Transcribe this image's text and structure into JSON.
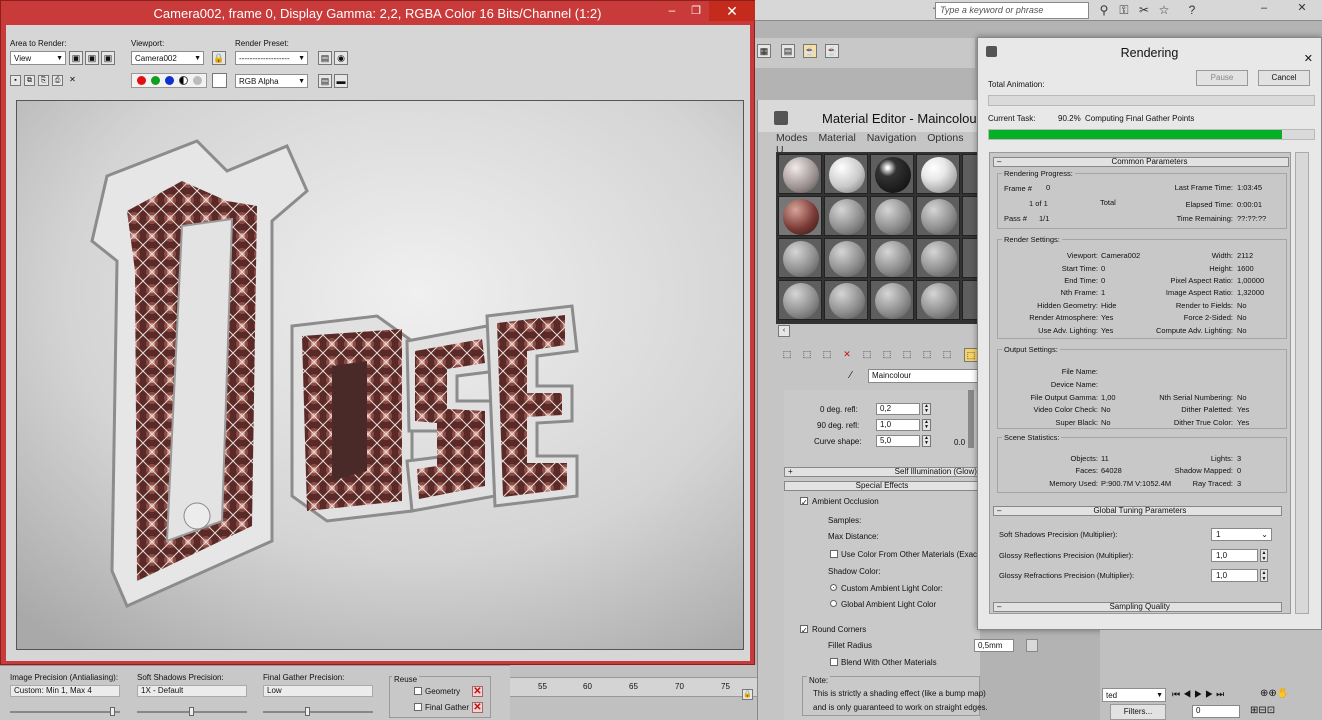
{
  "background": {
    "search_placeholder": "Type a keyword or phrase",
    "window_controls": [
      "–",
      "❐",
      "✕"
    ]
  },
  "vfb": {
    "title": "Camera002, frame 0, Display Gamma: 2,2, RGBA Color 16 Bits/Channel (1:2)",
    "area_label": "Area to Render:",
    "area_value": "View",
    "viewport_label": "Viewport:",
    "viewport_value": "Camera002",
    "preset_label": "Render Preset:",
    "preset_value": "-------------------",
    "channel_value": "RGB Alpha"
  },
  "bottom": {
    "image_precision_label": "Image Precision (Antialiasing):",
    "image_precision_value": "Custom: Min 1, Max 4",
    "soft_shadows_label": "Soft Shadows Precision:",
    "soft_shadows_value": "1X - Default",
    "final_gather_label": "Final Gather Precision:",
    "final_gather_value": "Low",
    "reuse_label": "Reuse",
    "geometry_label": "Geometry",
    "final_gather_check_label": "Final Gather",
    "timeline_ticks": [
      "55",
      "60",
      "65",
      "70",
      "75"
    ]
  },
  "material_editor": {
    "title": "Material Editor - Maincolour",
    "menu": [
      "Modes",
      "Material",
      "Navigation",
      "Options",
      "U"
    ],
    "material_name": "Maincolour",
    "refl_0_label": "0 deg. refl:",
    "refl_0_value": "0,2",
    "refl_90_label": "90 deg. refl:",
    "refl_90_value": "1,0",
    "curve_label": "Curve shape:",
    "curve_value": "5,0",
    "graph_value": "0.0",
    "self_illum": "Self Illumination (Glow)",
    "special_effects": "Special Effects",
    "ambient_occlusion": "Ambient Occlusion",
    "samples": "Samples:",
    "max_distance": "Max Distance:",
    "use_color": "Use Color From Other Materials (Exact A",
    "shadow_color": "Shadow Color:",
    "custom_ambient": "Custom Ambient Light Color:",
    "global_ambient": "Global Ambient Light Color",
    "round_corners": "Round Corners",
    "fillet_radius": "Fillet Radius",
    "fillet_value": "0,5mm",
    "blend": "Blend With Other Materials",
    "note_title": "Note:",
    "note_line1": "This is strictly a shading effect (like a bump map)",
    "note_line2": "and is only guaranteed to work on straight edges."
  },
  "rendering": {
    "title": "Rendering",
    "pause": "Pause",
    "cancel": "Cancel",
    "total_animation": "Total Animation:",
    "current_task_label": "Current Task:",
    "current_task_percent": "90.2%",
    "current_task_text": "Computing Final Gather Points",
    "current_task_progress": 0.902,
    "total_animation_progress": 0.0,
    "common_parameters": "Common Parameters",
    "progress": {
      "title": "Rendering Progress:",
      "frame_label": "Frame #",
      "frame_value": "0",
      "of_value": "1 of 1",
      "total": "Total",
      "pass_label": "Pass #",
      "pass_value": "1/1",
      "last_frame_label": "Last Frame Time:",
      "last_frame_value": "1:03:45",
      "elapsed_label": "Elapsed Time:",
      "elapsed_value": "0:00:01",
      "remaining_label": "Time Remaining:",
      "remaining_value": "??:??:??"
    },
    "render_settings": {
      "title": "Render Settings:",
      "left": [
        [
          "Viewport:",
          "Camera002"
        ],
        [
          "Start Time:",
          "0"
        ],
        [
          "End Time:",
          "0"
        ],
        [
          "Nth Frame:",
          "1"
        ],
        [
          "Hidden Geometry:",
          "Hide"
        ],
        [
          "Render Atmosphere:",
          "Yes"
        ],
        [
          "Use Adv. Lighting:",
          "Yes"
        ]
      ],
      "right": [
        [
          "Width:",
          "2112"
        ],
        [
          "Height:",
          "1600"
        ],
        [
          "Pixel Aspect Ratio:",
          "1,00000"
        ],
        [
          "Image Aspect Ratio:",
          "1,32000"
        ],
        [
          "Render to Fields:",
          "No"
        ],
        [
          "Force 2-Sided:",
          "No"
        ],
        [
          "Compute Adv. Lighting:",
          "No"
        ]
      ]
    },
    "output_settings": {
      "title": "Output Settings:",
      "left": [
        [
          "File Name:",
          ""
        ],
        [
          "Device Name:",
          ""
        ],
        [
          "File Output Gamma:",
          "1,00"
        ],
        [
          "Video Color Check:",
          "No"
        ],
        [
          "Super Black:",
          "No"
        ]
      ],
      "right": [
        [
          "Nth Serial Numbering:",
          "No"
        ],
        [
          "Dither Paletted:",
          "Yes"
        ],
        [
          "Dither True Color:",
          "Yes"
        ]
      ]
    },
    "scene_statistics": {
      "title": "Scene Statistics:",
      "left": [
        [
          "Objects:",
          "11"
        ],
        [
          "Faces:",
          "64028"
        ],
        [
          "Memory Used:",
          "P:900.7M V:1052.4M"
        ]
      ],
      "right": [
        [
          "Lights:",
          "3"
        ],
        [
          "Shadow Mapped:",
          "0"
        ],
        [
          "Ray Traced:",
          "3"
        ]
      ]
    },
    "global_tuning": "Global Tuning Parameters",
    "soft_shadows_mult_label": "Soft Shadows Precision (Multiplier):",
    "soft_shadows_mult_value": "1",
    "glossy_refl_label": "Glossy Reflections Precision (Multiplier):",
    "glossy_refl_value": "1,0",
    "glossy_refr_label": "Glossy Refractions Precision (Multiplier):",
    "glossy_refr_value": "1,0",
    "sampling_quality": "Sampling Quality"
  },
  "rb": {
    "filter_value": "ted",
    "filters_label": "Filters...",
    "frame_value": "0"
  }
}
